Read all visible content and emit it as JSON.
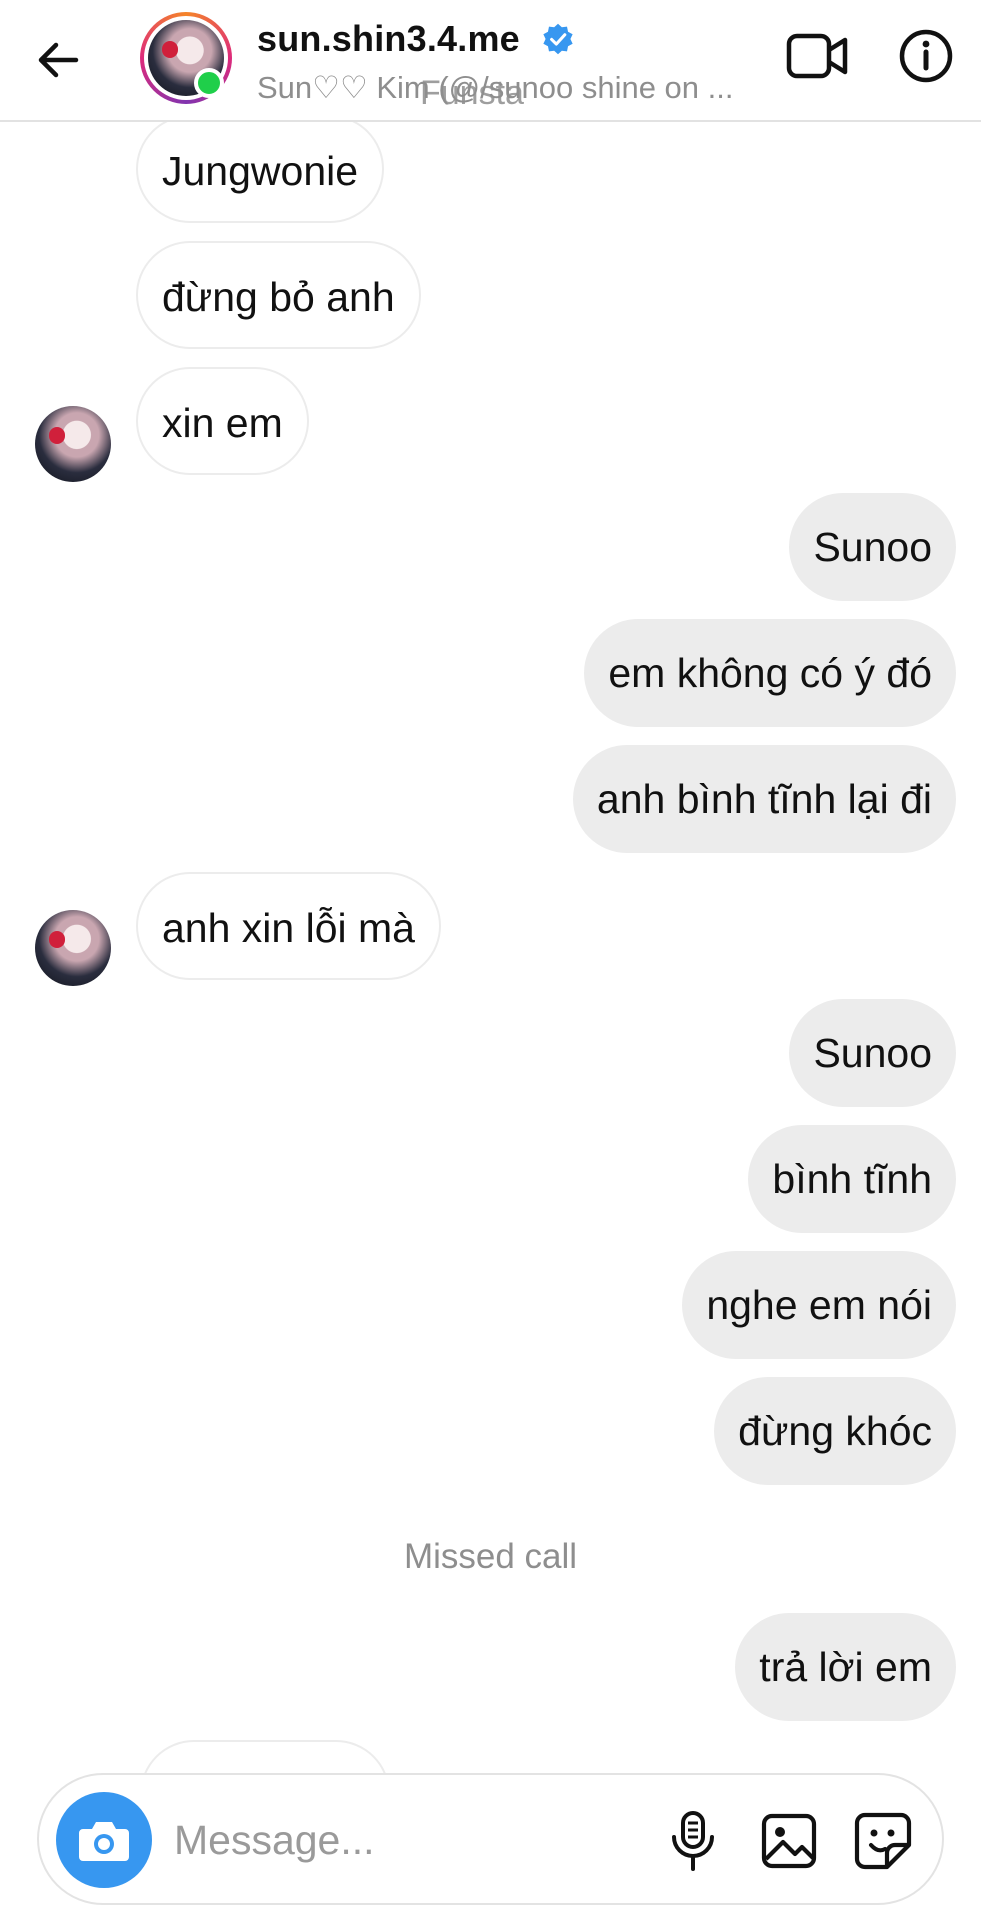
{
  "header": {
    "username": "sun.shin3.4.me",
    "subtitle": "Sun♡♡ Kim (@/sunoo shine on ...",
    "overlay": "Funsta",
    "icons": {
      "back": "arrow-left-icon",
      "verified": "verified-badge-icon",
      "video": "video-call-icon",
      "info": "info-icon"
    },
    "online": true
  },
  "messages": [
    {
      "side": "in",
      "text": "Jungwonie"
    },
    {
      "side": "in",
      "text": "đừng bỏ anh"
    },
    {
      "side": "in",
      "text": "xin em"
    },
    {
      "side": "out",
      "text": "Sunoo"
    },
    {
      "side": "out",
      "text": "em không có ý đó"
    },
    {
      "side": "out",
      "text": "anh bình tĩnh lại đi"
    },
    {
      "side": "in",
      "text": "anh xin lỗi mà"
    },
    {
      "side": "out",
      "text": "Sunoo"
    },
    {
      "side": "out",
      "text": "bình tĩnh"
    },
    {
      "side": "out",
      "text": "nghe em nói"
    },
    {
      "side": "out",
      "text": "đừng khóc"
    },
    {
      "side": "out",
      "text": "trả lời em"
    }
  ],
  "system": {
    "missed_call": "Missed call"
  },
  "composer": {
    "placeholder": "Message...",
    "icons": {
      "camera": "camera-icon",
      "mic": "microphone-icon",
      "gallery": "image-icon",
      "sticker": "sticker-icon"
    }
  },
  "colors": {
    "accent": "#3797f0",
    "verified": "#3797f0",
    "online": "#1fcf4a",
    "bubble_out": "#ececec",
    "bubble_in_border": "#ececec",
    "secondary_text": "#8e8e8e"
  }
}
